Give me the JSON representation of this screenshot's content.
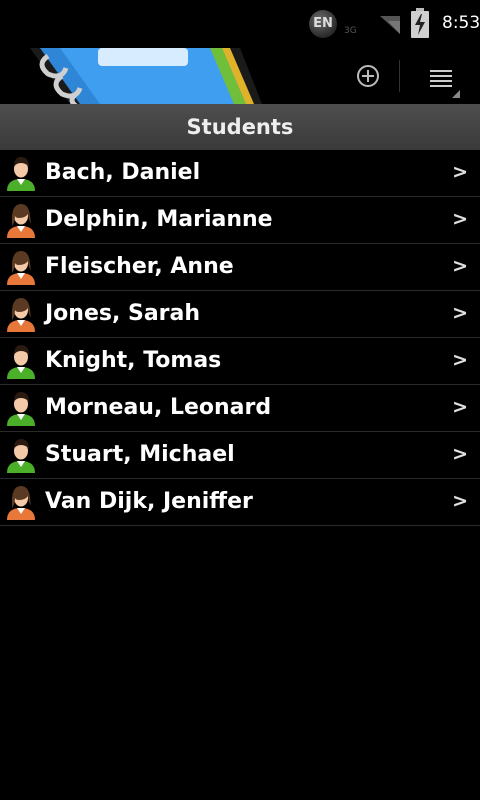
{
  "status_bar": {
    "ime": "EN",
    "network": "3G",
    "time": "8:53"
  },
  "header": {
    "title": "Students"
  },
  "students": [
    {
      "name": "Bach, Daniel",
      "avatar": "male-avatar-icon",
      "chevron": ">"
    },
    {
      "name": "Delphin, Marianne",
      "avatar": "female-avatar-icon",
      "chevron": ">"
    },
    {
      "name": "Fleischer, Anne",
      "avatar": "female-avatar-icon",
      "chevron": ">"
    },
    {
      "name": "Jones, Sarah",
      "avatar": "female-avatar-icon",
      "chevron": ">"
    },
    {
      "name": "Knight, Tomas",
      "avatar": "male-avatar-icon",
      "chevron": ">"
    },
    {
      "name": "Morneau, Leonard",
      "avatar": "male-avatar-icon",
      "chevron": ">"
    },
    {
      "name": "Stuart, Michael",
      "avatar": "male-avatar-icon",
      "chevron": ">"
    },
    {
      "name": "Van Dijk, Jeniffer",
      "avatar": "female-avatar-icon",
      "chevron": ">"
    }
  ],
  "colors": {
    "male_avatar_shirt": "#4caf2a",
    "female_avatar_shirt": "#e8773a",
    "title_bar": "#444444"
  }
}
